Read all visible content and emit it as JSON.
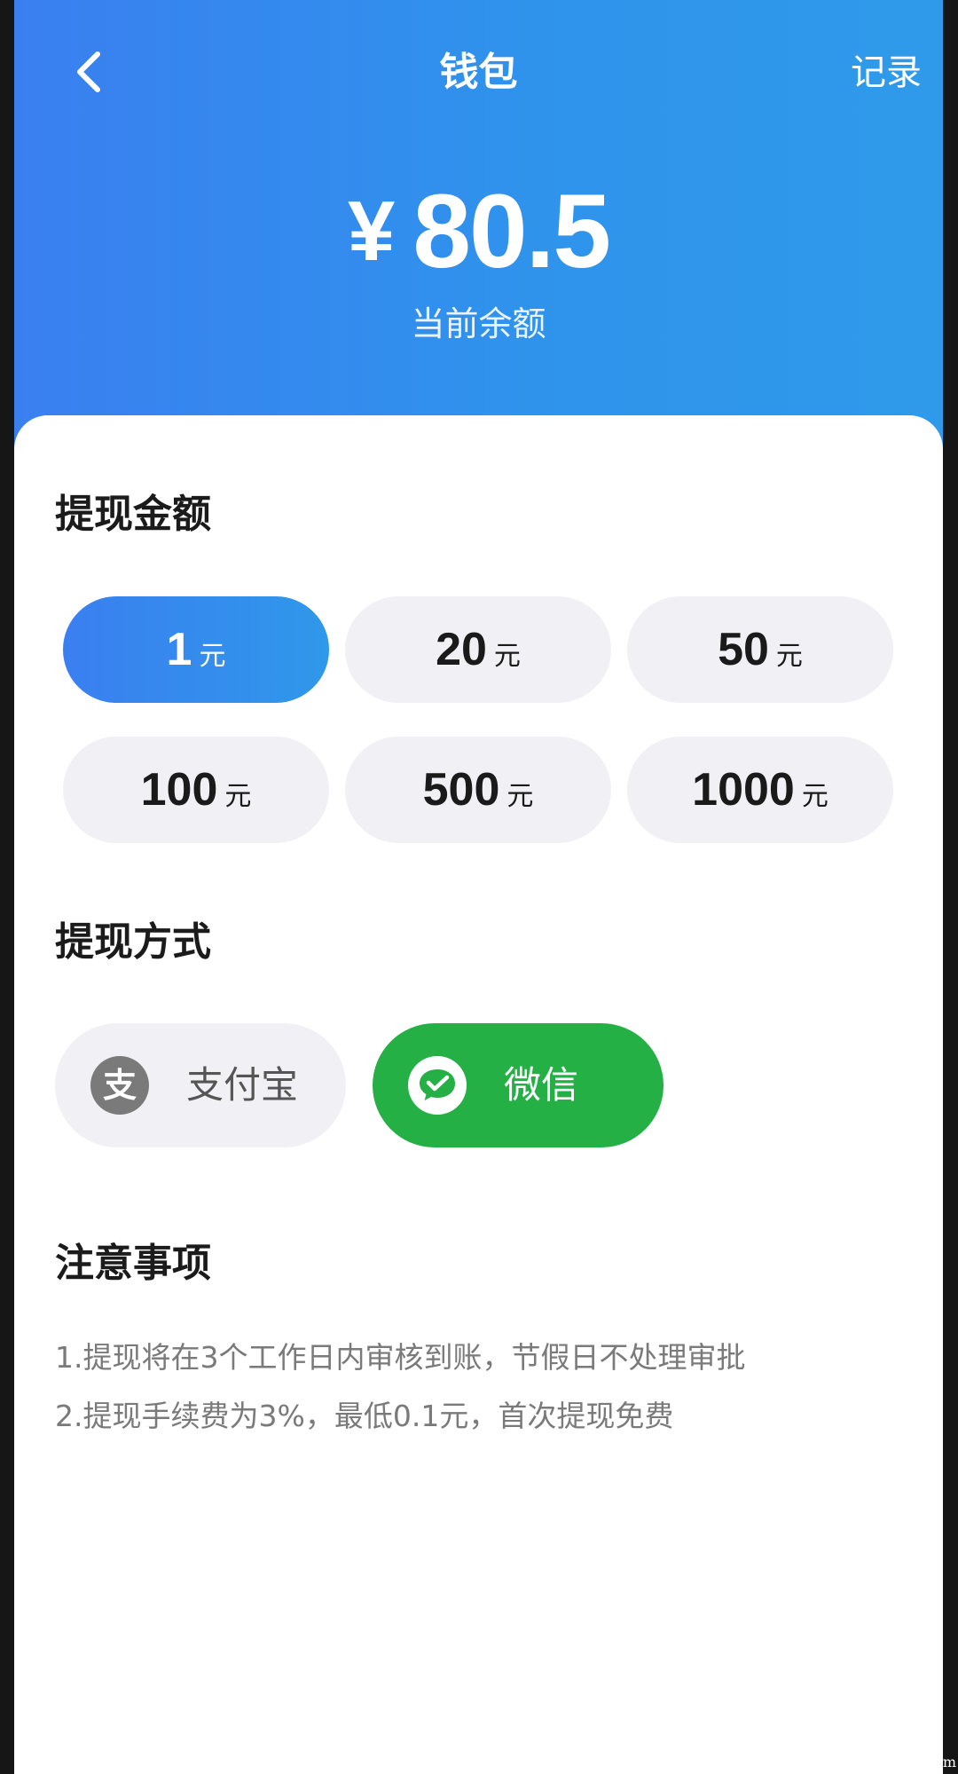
{
  "nav": {
    "title": "钱包",
    "record_label": "记录",
    "back_icon": "chevron-left-icon"
  },
  "balance": {
    "currency": "¥",
    "amount": "80.5",
    "label": "当前余额"
  },
  "withdraw_amount": {
    "title": "提现金额",
    "unit": "元",
    "options": [
      "1",
      "20",
      "50",
      "100",
      "500",
      "1000"
    ],
    "selected": "1"
  },
  "withdraw_method": {
    "title": "提现方式",
    "options": [
      {
        "label": "支付宝",
        "icon": "alipay-icon",
        "glyph": "支",
        "selected": false
      },
      {
        "label": "微信",
        "icon": "wechat-icon",
        "selected": true
      }
    ]
  },
  "notes": {
    "title": "注意事项",
    "lines": [
      "1.提现将在3个工作日内审核到账，节假日不处理审批",
      "2.提现手续费为3%，最低0.1元，首次提现免费"
    ]
  },
  "colors": {
    "header_start": "#3a7ff0",
    "header_end": "#2f9ae9",
    "selected_blue": "#3a7ff0",
    "wechat_green": "#24b045",
    "option_gray": "#f1f1f5"
  },
  "corner_mark": "m"
}
